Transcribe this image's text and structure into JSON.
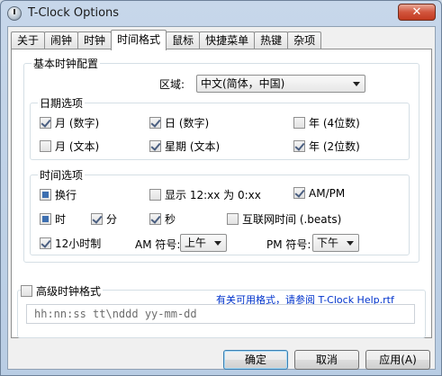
{
  "window": {
    "title": "T-Clock Options",
    "close_label": "✕"
  },
  "tabs": [
    {
      "label": "关于"
    },
    {
      "label": "闹钟"
    },
    {
      "label": "时钟"
    },
    {
      "label": "时间格式",
      "active": true
    },
    {
      "label": "鼠标"
    },
    {
      "label": "快捷菜单"
    },
    {
      "label": "热键"
    },
    {
      "label": "杂项"
    }
  ],
  "basic": {
    "legend": "基本时钟配置",
    "region_label": "区域:",
    "region_value": "中文(简体，中国)"
  },
  "date_options": {
    "legend": "日期选项",
    "month_number": {
      "label": "月 (数字)",
      "checked": true
    },
    "day_number": {
      "label": "日 (数字)",
      "checked": true
    },
    "year_4": {
      "label": "年 (4位数)",
      "checked": false
    },
    "month_text": {
      "label": "月 (文本)",
      "checked": false
    },
    "weekday_text": {
      "label": "星期 (文本)",
      "checked": true
    },
    "year_2": {
      "label": "年 (2位数)",
      "checked": true
    }
  },
  "time_options": {
    "legend": "时间选项",
    "line_break": {
      "label": "换行"
    },
    "show_zero": {
      "label": "显示 12:xx 为 0:xx",
      "checked": false
    },
    "ampm": {
      "label": "AM/PM",
      "checked": true
    },
    "hour": {
      "label": "时"
    },
    "minute": {
      "label": "分",
      "checked": true
    },
    "second": {
      "label": "秒",
      "checked": true
    },
    "internet_time": {
      "label": "互联网时间 (.beats)",
      "checked": false
    },
    "h12": {
      "label": "12小时制",
      "checked": true
    },
    "am_label": "AM 符号:",
    "am_value": "上午",
    "pm_label": "PM 符号:",
    "pm_value": "下午"
  },
  "advanced": {
    "label": "高级时钟格式",
    "checked": false,
    "help_text": "有关可用格式，请参阅 ",
    "help_link": "T-Clock Help.rtf",
    "format_value": "hh:nn:ss tt\\nddd yy-mm-dd"
  },
  "buttons": {
    "ok": "确定",
    "cancel": "取消",
    "apply": "应用(A)"
  }
}
